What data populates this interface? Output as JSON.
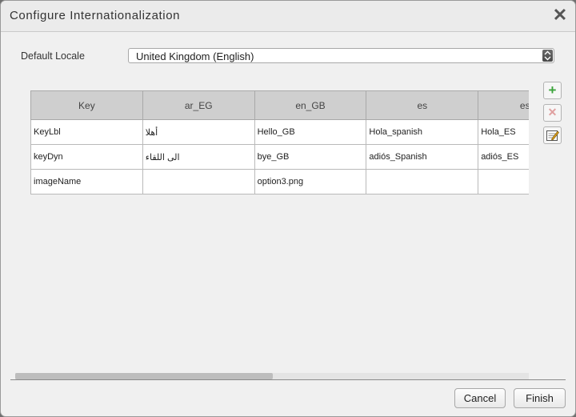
{
  "dialog": {
    "title": "Configure Internationalization",
    "close_icon": "close-icon"
  },
  "locale": {
    "label": "Default Locale",
    "selected": "United Kingdom (English)"
  },
  "table": {
    "headers": [
      "Key",
      "ar_EG",
      "en_GB",
      "es",
      "es_ES"
    ],
    "rows": [
      [
        "KeyLbl",
        "أهلا",
        "Hello_GB",
        "Hola_spanish",
        "Hola_ES"
      ],
      [
        "keyDyn",
        "الى اللقاء",
        "bye_GB",
        "adiós_Spanish",
        "adiós_ES"
      ],
      [
        "imageName",
        "",
        "option3.png",
        "",
        ""
      ]
    ]
  },
  "side_buttons": {
    "add_icon": "plus-icon",
    "remove_icon": "close-icon",
    "edit_icon": "edit-icon"
  },
  "footer": {
    "cancel_label": "Cancel",
    "finish_label": "Finish"
  },
  "colors": {
    "add": "#3aa33a",
    "remove": "#e0a0a0",
    "header_bg": "#cfcfcf"
  }
}
